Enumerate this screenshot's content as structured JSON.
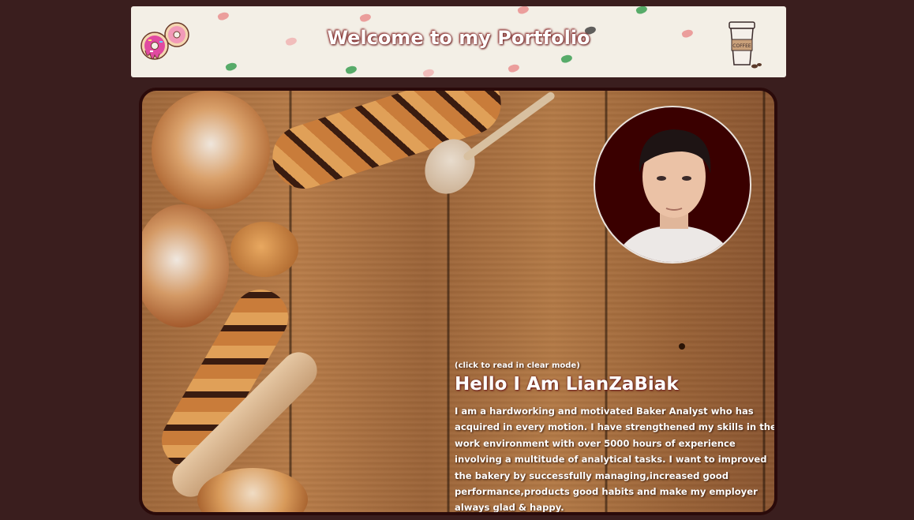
{
  "header": {
    "title": "Welcome to my Portfolio",
    "left_icon": "donut-icon",
    "right_icon": "coffee-cup-icon",
    "coffee_label": "COFFEE"
  },
  "hero": {
    "clear_mode_link": "(click to read in clear mode)",
    "heading": "Hello I Am LianZaBiak",
    "bio": "I am a hardworking and motivated Baker Analyst who has acquired in every motion. I have strengthened my skills in the work environment with over 5000 hours of experience involving a multitude of analytical tasks. I want to improved the bakery by successfully managing,increased good performance,products good habits and make my employer always glad & happy."
  },
  "colors": {
    "page_background": "#3a1e1e",
    "header_background": "#f3efe6",
    "card_border": "#2a0a0a",
    "photo_background": "#3a0000"
  }
}
